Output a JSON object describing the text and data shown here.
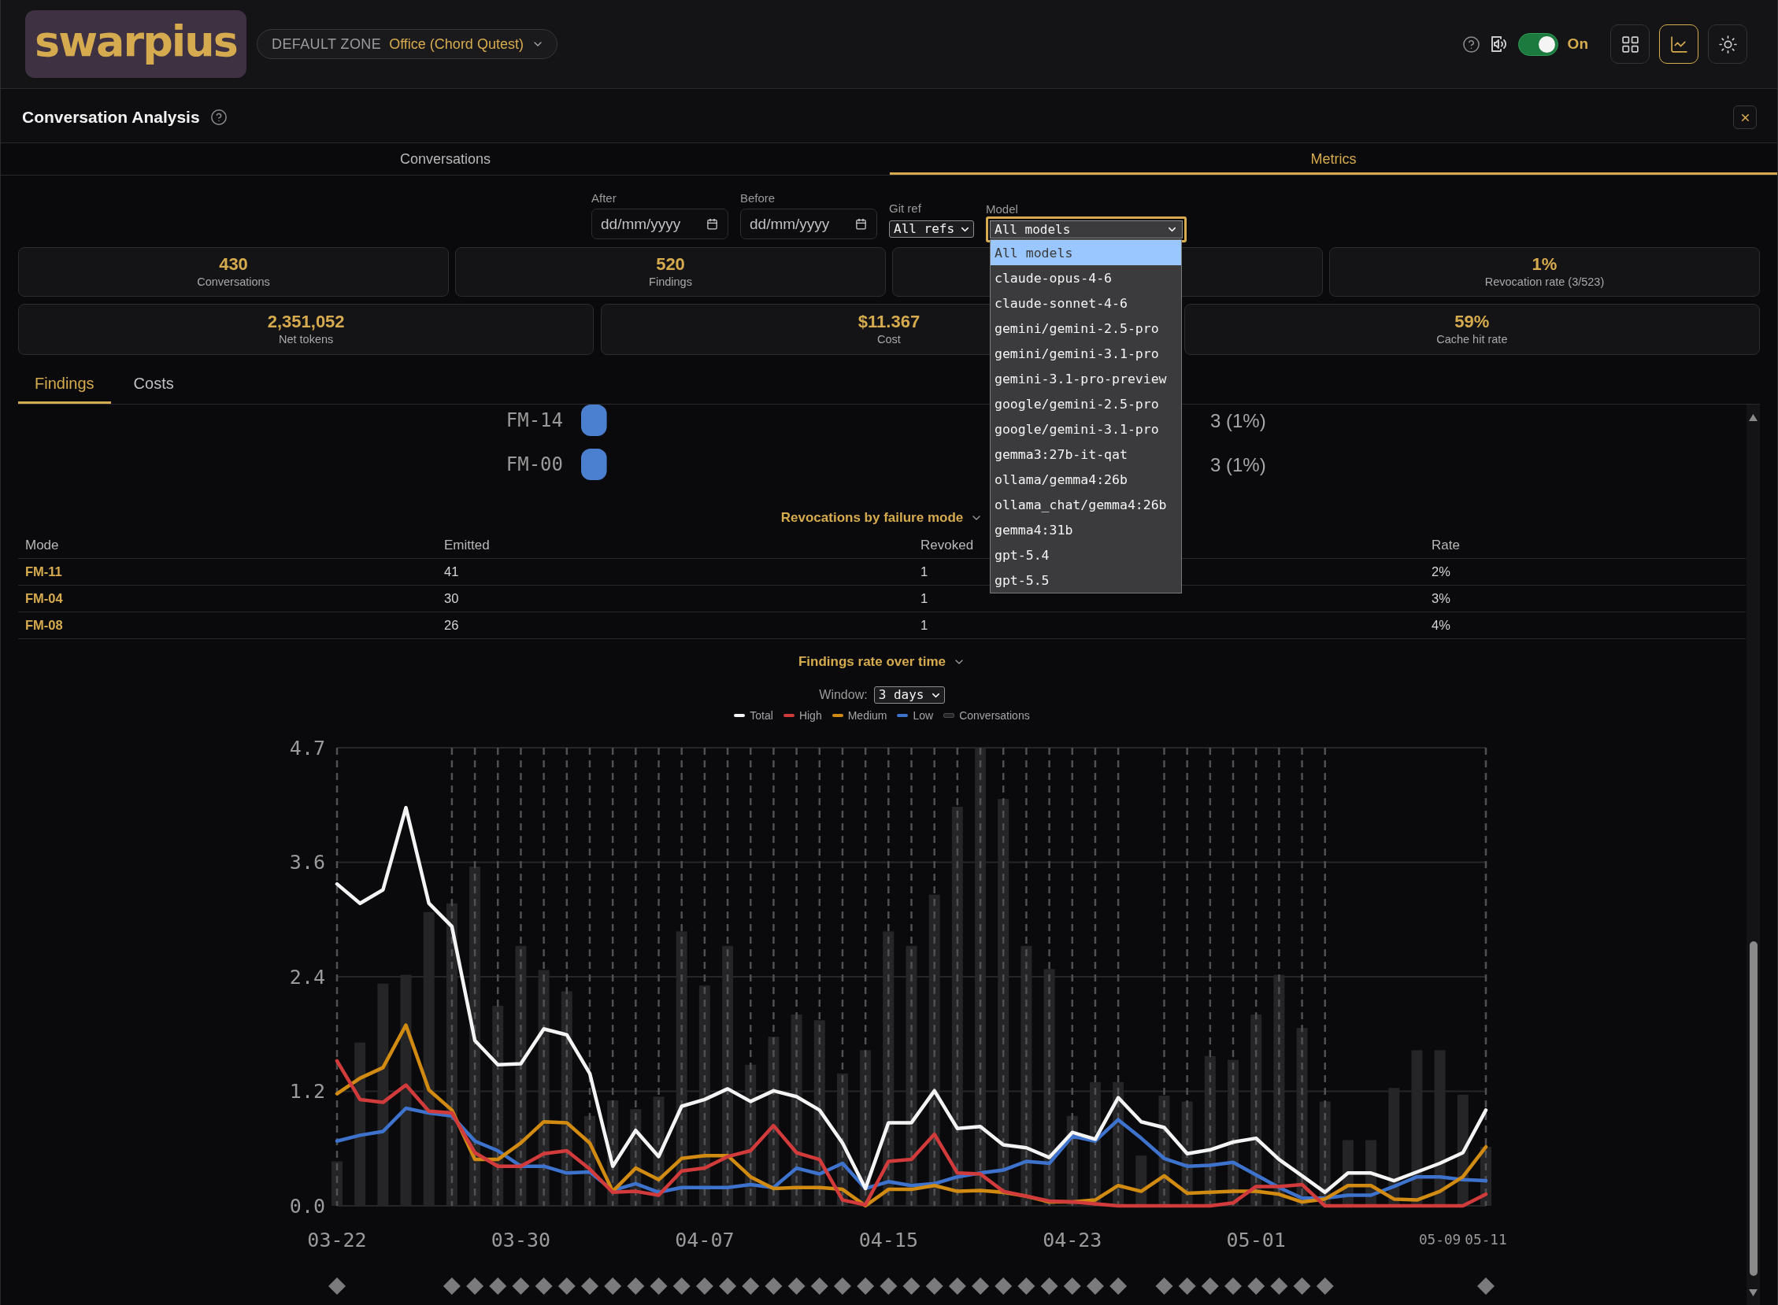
{
  "header": {
    "logo": "swarpius",
    "zone": {
      "label": "DEFAULT ZONE",
      "value": "Office (Chord Qutest)"
    },
    "toggle": {
      "label": "On",
      "on": true
    },
    "view_buttons": [
      {
        "kind": "grid",
        "selected": false
      },
      {
        "kind": "chart",
        "selected": true
      },
      {
        "kind": "theme",
        "selected": false
      }
    ]
  },
  "panel": {
    "title": "Conversation Analysis"
  },
  "tabs": [
    {
      "label": "Conversations",
      "selected": false
    },
    {
      "label": "Metrics",
      "selected": true
    }
  ],
  "filters": {
    "after": {
      "label": "After",
      "placeholder": "dd/mm/yyyy"
    },
    "before": {
      "label": "Before",
      "placeholder": "dd/mm/yyyy"
    },
    "git_ref": {
      "label": "Git ref",
      "value": "All refs"
    },
    "model": {
      "label": "Model",
      "value": "All models",
      "open": true,
      "options": [
        {
          "label": "All models",
          "selected": true
        },
        {
          "label": "claude-opus-4-6",
          "selected": false
        },
        {
          "label": "claude-sonnet-4-6",
          "selected": false
        },
        {
          "label": "gemini/gemini-2.5-pro",
          "selected": false
        },
        {
          "label": "gemini/gemini-3.1-pro",
          "selected": false
        },
        {
          "label": "gemini-3.1-pro-preview",
          "selected": false
        },
        {
          "label": "google/gemini-2.5-pro",
          "selected": false
        },
        {
          "label": "google/gemini-3.1-pro",
          "selected": false
        },
        {
          "label": "gemma3:27b-it-qat",
          "selected": false
        },
        {
          "label": "ollama/gemma4:26b",
          "selected": false
        },
        {
          "label": "ollama_chat/gemma4:26b",
          "selected": false
        },
        {
          "label": "gemma4:31b",
          "selected": false
        },
        {
          "label": "gpt-5.4",
          "selected": false
        },
        {
          "label": "gpt-5.5",
          "selected": false
        }
      ]
    }
  },
  "stats_row_1": [
    {
      "value": "430",
      "label": "Conversations"
    },
    {
      "value": "520",
      "label": "Findings"
    },
    {
      "value": "1%",
      "label": "Revocation rate (3/523)"
    }
  ],
  "stats_row_2": [
    {
      "value": "2,351,052",
      "label": "Net tokens"
    },
    {
      "value": "$11.367",
      "label": "Cost"
    },
    {
      "value": "59%",
      "label": "Cache hit rate"
    }
  ],
  "sub_tabs": [
    {
      "label": "Findings",
      "selected": true
    },
    {
      "label": "Costs",
      "selected": false
    }
  ],
  "findings": {
    "failure_modes": {
      "chart_data": {
        "type": "bar",
        "orientation": "horizontal",
        "categories": [
          "FM-14",
          "FM-00"
        ],
        "values": [
          3,
          3
        ],
        "value_labels": [
          "3 (1%)",
          "3 (1%)"
        ]
      }
    },
    "revocations": {
      "title": "Revocations by failure mode",
      "expanded": true,
      "columns": [
        "Mode",
        "Emitted",
        "Revoked",
        "Rate"
      ],
      "rows": [
        [
          "FM-11",
          "41",
          "1",
          "2%"
        ],
        [
          "FM-04",
          "30",
          "1",
          "3%"
        ],
        [
          "FM-08",
          "26",
          "1",
          "4%"
        ]
      ]
    },
    "rate_over_time": {
      "expanded": true,
      "window": {
        "label": "Window:",
        "value": "3 days"
      },
      "event_markers": [
        true,
        false,
        false,
        false,
        false,
        true,
        true,
        true,
        true,
        true,
        true,
        true,
        true,
        true,
        true,
        true,
        true,
        true,
        true,
        true,
        true,
        true,
        true,
        true,
        true,
        true,
        true,
        true,
        true,
        true,
        true,
        true,
        true,
        true,
        true,
        false,
        true,
        true,
        true,
        true,
        true,
        true,
        true,
        true,
        false,
        false,
        false,
        false,
        false,
        false,
        true
      ],
      "chart_data": {
        "type": "line",
        "title": "Findings rate over time",
        "categories": [
          "03-22",
          null,
          null,
          null,
          null,
          null,
          null,
          null,
          "03-30",
          null,
          null,
          null,
          null,
          null,
          null,
          null,
          "04-07",
          null,
          null,
          null,
          null,
          null,
          null,
          null,
          "04-15",
          null,
          null,
          null,
          null,
          null,
          null,
          null,
          "04-23",
          null,
          null,
          null,
          null,
          null,
          null,
          null,
          "05-01",
          null,
          null,
          null,
          null,
          null,
          null,
          null,
          "05-09",
          null,
          "05-11"
        ],
        "ylim": [
          0,
          4.74
        ],
        "grid": true,
        "yticks": [
          {
            "value": 0,
            "label": "0.0"
          },
          {
            "value": 1.185,
            "label": "1.2"
          },
          {
            "value": 2.37,
            "label": "2.4"
          },
          {
            "value": 3.555,
            "label": "3.6"
          },
          {
            "value": 4.74,
            "label": "4.7"
          }
        ],
        "series": [
          {
            "name": "Total",
            "type": "line",
            "color": "#f4f4f4",
            "values": [
              3.33,
              3.13,
              3.27,
              4.12,
              3.13,
              2.89,
              1.71,
              1.46,
              1.47,
              1.83,
              1.77,
              1.37,
              0.41,
              0.78,
              0.51,
              1.03,
              1.1,
              1.21,
              1.08,
              1.19,
              1.13,
              0.99,
              0.65,
              0.18,
              0.86,
              0.86,
              1.19,
              0.8,
              0.82,
              0.63,
              0.6,
              0.5,
              0.76,
              0.69,
              1.12,
              0.87,
              0.81,
              0.54,
              0.58,
              0.66,
              0.7,
              0.48,
              0.31,
              0.14,
              0.34,
              0.34,
              0.26,
              0.35,
              0.44,
              0.55,
              0.99
            ]
          },
          {
            "name": "High",
            "type": "line",
            "color": "#d13b3b",
            "values": [
              1.5,
              1.1,
              1.07,
              1.25,
              0.98,
              0.96,
              0.55,
              0.41,
              0.41,
              0.54,
              0.57,
              0.38,
              0.14,
              0.15,
              0.11,
              0.36,
              0.39,
              0.51,
              0.57,
              0.83,
              0.55,
              0.48,
              0.06,
              0.01,
              0.46,
              0.48,
              0.74,
              0.34,
              0.33,
              0.15,
              0.1,
              0.05,
              0.04,
              0.02,
              0,
              0,
              0,
              0,
              0,
              0.03,
              0.2,
              0.2,
              0.22,
              0,
              0,
              0,
              0,
              0,
              0,
              0,
              0.12
            ]
          },
          {
            "name": "Medium",
            "type": "line",
            "color": "#d18a12",
            "values": [
              1.16,
              1.32,
              1.43,
              1.87,
              1.2,
              0.99,
              0.48,
              0.48,
              0.65,
              0.87,
              0.86,
              0.65,
              0.15,
              0.39,
              0.27,
              0.49,
              0.52,
              0.52,
              0.3,
              0.18,
              0.19,
              0.19,
              0.17,
              0,
              0.17,
              0.17,
              0.21,
              0.15,
              0.16,
              0.14,
              0.1,
              0.04,
              0.04,
              0.06,
              0.21,
              0.15,
              0.31,
              0.13,
              0.14,
              0.15,
              0.15,
              0.12,
              0.04,
              0.07,
              0.21,
              0.21,
              0.07,
              0.06,
              0.15,
              0.3,
              0.61
            ]
          },
          {
            "name": "Low",
            "type": "line",
            "color": "#3d73cc",
            "values": [
              0.67,
              0.73,
              0.77,
              1.01,
              0.96,
              0.93,
              0.67,
              0.57,
              0.41,
              0.41,
              0.34,
              0.35,
              0.16,
              0.23,
              0.14,
              0.19,
              0.19,
              0.19,
              0.22,
              0.19,
              0.39,
              0.33,
              0.44,
              0.18,
              0.25,
              0.21,
              0.23,
              0.3,
              0.34,
              0.37,
              0.46,
              0.44,
              0.72,
              0.67,
              0.89,
              0.7,
              0.49,
              0.41,
              0.42,
              0.45,
              0.32,
              0.19,
              0.08,
              0.08,
              0.11,
              0.11,
              0.2,
              0.3,
              0.3,
              0.27,
              0.26
            ]
          },
          {
            "name": "Conversations",
            "type": "bar",
            "color": "#252527",
            "values": [
              0.46,
              1.69,
              2.3,
              2.39,
              3.04,
              3.13,
              3.51,
              2.07,
              2.69,
              2.44,
              2.22,
              0.93,
              1.09,
              1.0,
              1.13,
              2.84,
              2.28,
              2.69,
              1.46,
              1.75,
              1.98,
              1.92,
              1.37,
              1.61,
              2.84,
              2.69,
              3.22,
              4.13,
              4.74,
              4.21,
              2.69,
              2.45,
              0.93,
              1.28,
              1.28,
              0.52,
              1.14,
              1.08,
              1.55,
              1.51,
              1.98,
              2.39,
              1.84,
              1.08,
              0.68,
              0.68,
              1.22,
              1.61,
              1.61,
              1.15,
              0.61
            ]
          }
        ]
      }
    }
  }
}
